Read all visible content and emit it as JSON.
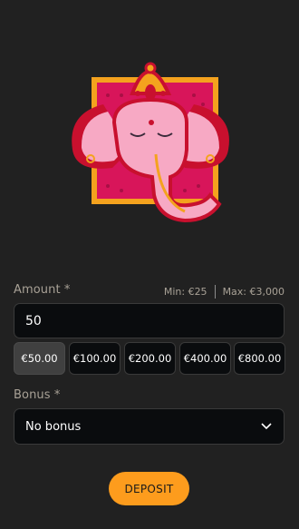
{
  "amount": {
    "label": "Amount *",
    "min": "Min: €25",
    "max": "Max: €3,000",
    "value": "50"
  },
  "presets": [
    "€50.00",
    "€100.00",
    "€200.00",
    "€400.00",
    "€800.00"
  ],
  "bonus": {
    "label": "Bonus *",
    "selected": "No bonus"
  },
  "deposit_label": "DEPOSIT",
  "colors": {
    "background": "#212121",
    "input_bg": "#0a0c0e",
    "accent": "#fd9c1d",
    "logo_red": "#c8102e",
    "logo_pink": "#f7a9c4",
    "logo_gold": "#f4a21e"
  },
  "icons": {
    "logo": "ganesha-elephant-icon",
    "dropdown": "chevron-down-icon"
  }
}
